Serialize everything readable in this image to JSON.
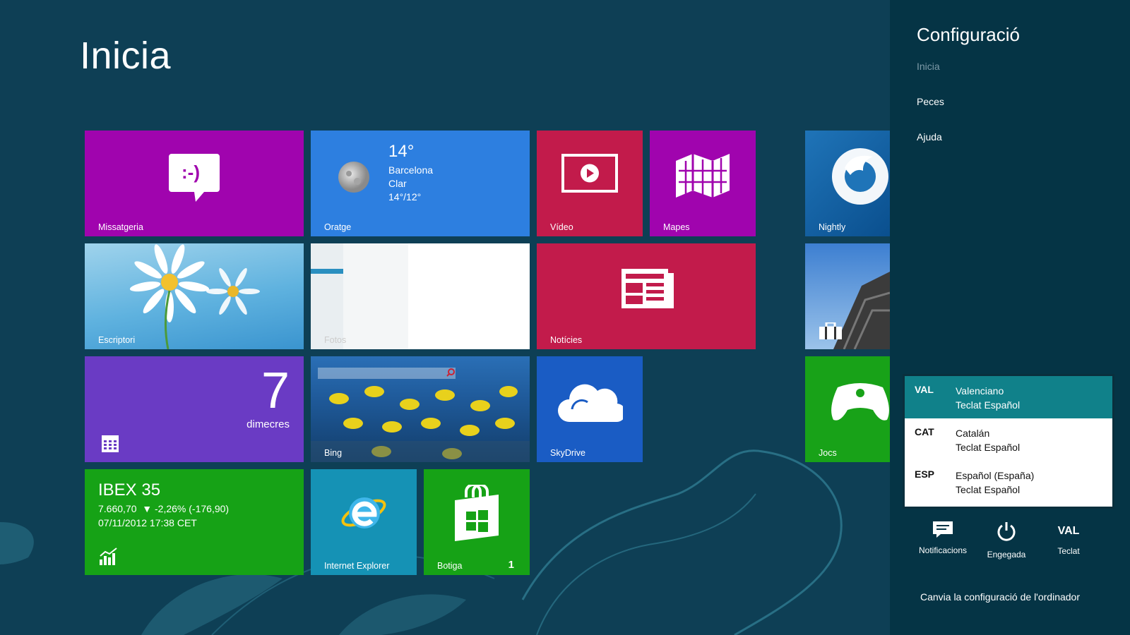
{
  "start": {
    "title": "Inicia"
  },
  "tiles": {
    "messaging": {
      "label": "Missatgeria",
      "glyph": ":-)",
      "color": "#a004ae",
      "icon": "smiley-speech-bubble-icon"
    },
    "weather": {
      "label": "Oratge",
      "temp": "14°",
      "city": "Barcelona",
      "condition": "Clar",
      "range": "14°/12°",
      "color": "#2d7fe0",
      "icon": "moon-icon"
    },
    "video": {
      "label": "Vídeo",
      "color": "#c21b4b",
      "icon": "play-screen-icon"
    },
    "maps": {
      "label": "Mapes",
      "color": "#a004ae",
      "icon": "folded-map-icon"
    },
    "nightly": {
      "label": "Nightly",
      "icon": "nightly-browser-icon"
    },
    "desktop": {
      "label": "Escriptori",
      "icon": "daisy-wallpaper-icon"
    },
    "photos": {
      "label": "Fotos"
    },
    "news": {
      "label": "Notícies",
      "color": "#c21b4b",
      "icon": "newspaper-icon"
    },
    "travel": {
      "icon": "suitcase-icon"
    },
    "calendar": {
      "day": "7",
      "weekday": "dimecres",
      "color": "#6a3bc4",
      "icon": "calendar-grid-icon"
    },
    "bing": {
      "label": "Bing",
      "icon": "search-icon"
    },
    "skydrive": {
      "label": "SkyDrive",
      "color": "#1a5cc4",
      "icon": "cloud-icon"
    },
    "games": {
      "label": "Jocs",
      "color": "#18a218",
      "icon": "game-controller-icon"
    },
    "finance": {
      "index": "IBEX 35",
      "change": "7.660,70  ▼ -2,26% (-176,90)",
      "timestamp": "07/11/2012 17:38 CET",
      "color": "#16a216",
      "icon": "rising-chart-icon"
    },
    "ie": {
      "label": "Internet Explorer",
      "color": "#1592b5",
      "icon": "ie-logo-icon"
    },
    "store": {
      "label": "Botiga",
      "badge": "1",
      "color": "#16a216",
      "icon": "shopping-bag-windows-icon"
    }
  },
  "settings": {
    "title": "Configuració",
    "context": "Inicia",
    "links": [
      "Peces",
      "Ajuda"
    ],
    "languages": [
      {
        "code": "VAL",
        "name": "Valenciano",
        "keyboard": "Teclat Español",
        "selected": true
      },
      {
        "code": "CAT",
        "name": "Catalán",
        "keyboard": "Teclat Español",
        "selected": false
      },
      {
        "code": "ESP",
        "name": "Español (España)",
        "keyboard": "Teclat Español",
        "selected": false
      }
    ],
    "quick_actions": {
      "notifications": {
        "label": "Notificacions",
        "icon": "notifications-icon"
      },
      "power": {
        "label": "Engegada",
        "icon": "power-icon"
      },
      "keyboard": {
        "label": "Teclat",
        "value": "VAL"
      }
    },
    "change_pc": "Canvia la configuració de l'ordinador"
  }
}
